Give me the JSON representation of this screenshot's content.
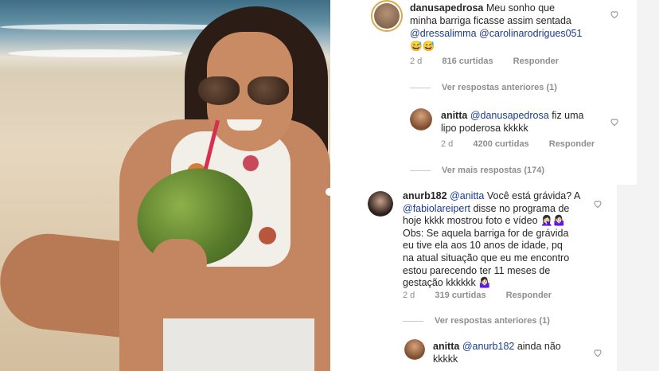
{
  "colors": {
    "mention": "#1a3b8f",
    "meta": "#8e8e8e",
    "text": "#262626"
  },
  "comments": [
    {
      "user": "danusapedrosa",
      "text_before": "Meu sonho que",
      "line2": "minha barriga ficasse assim sentada",
      "mention1": "@dressalimma",
      "mention2": "@carolinarodrigues051",
      "emoji": "😅😅",
      "time": "2 d",
      "likes": "816 curtidas",
      "reply": "Responder",
      "thread": "Ver respostas anteriores (1)"
    },
    {
      "user": "anitta",
      "mention": "@danusapedrosa",
      "text_after": "fiz uma",
      "line2": "lipo poderosa kkkkk",
      "time": "2 d",
      "likes": "4200 curtidas",
      "reply": "Responder",
      "thread": "Ver mais respostas (174)"
    },
    {
      "user": "anurb182",
      "mention": "@anitta",
      "line1_text": "Você está grávida? A",
      "mention2": "@fabiolareipert",
      "line2_text": "disse no programa de",
      "line3": "hoje kkkk mostrou foto e vídeo 🤦🏻‍♀️🤷🏻‍♀️",
      "line4": "Obs: Se aquela barriga for de grávida",
      "line5": "eu tive ela aos 10 anos de idade, pq",
      "line6": "na atual situação que eu me encontro",
      "line7": "estou parecendo ter 11 meses de",
      "line8": "gestação kkkkkk 🤷🏻‍♀️",
      "time": "2 d",
      "likes": "319 curtidas",
      "reply": "Responder",
      "thread": "Ver respostas anteriores (1)"
    },
    {
      "user": "anitta",
      "mention": "@anurb182",
      "text_after": "ainda não",
      "line2": "kkkkk"
    }
  ]
}
